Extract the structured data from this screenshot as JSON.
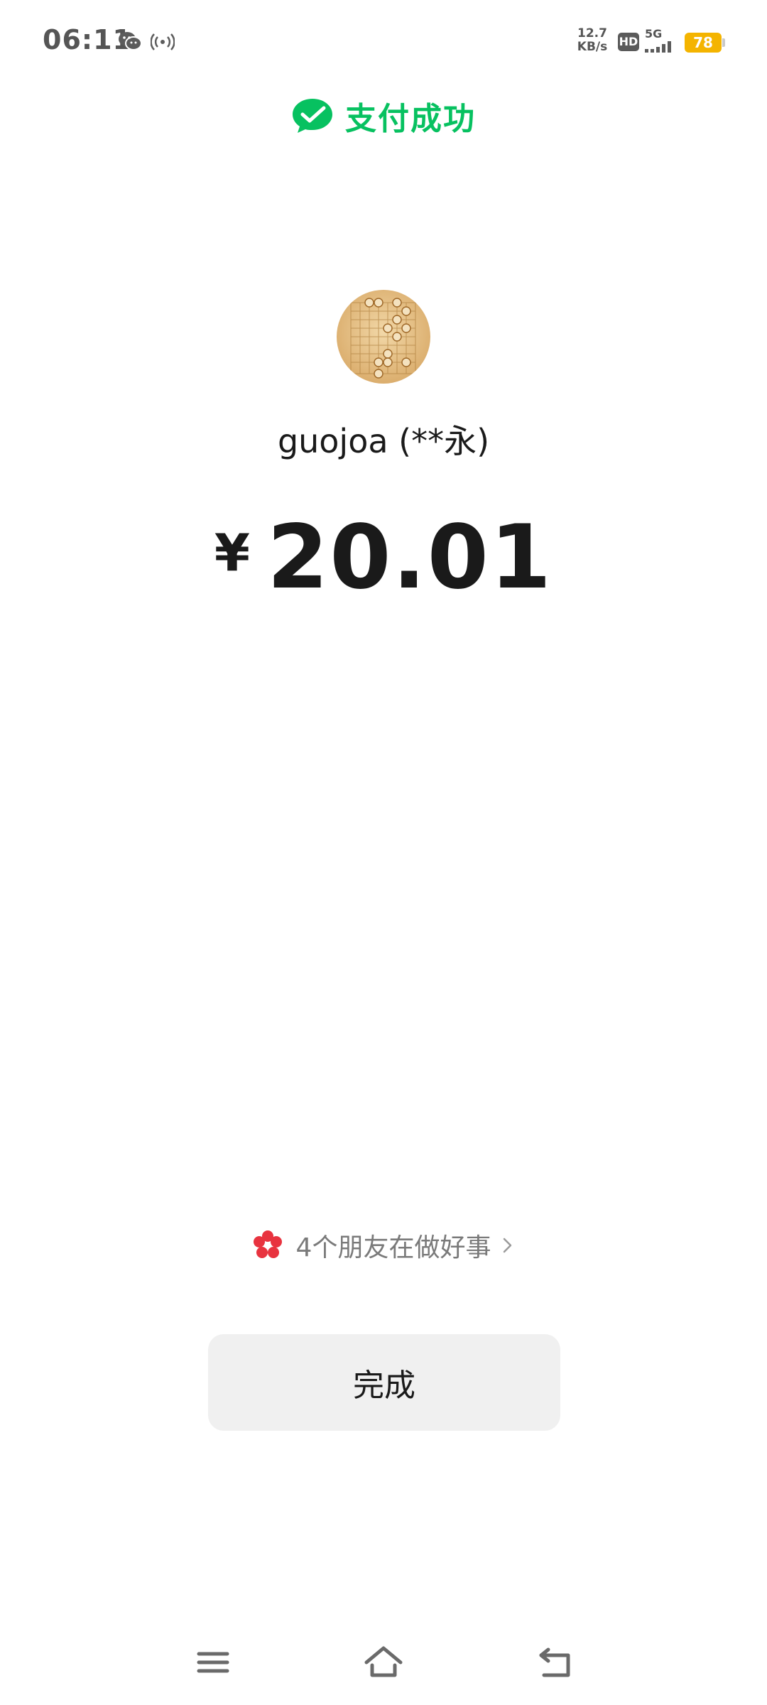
{
  "status_bar": {
    "time": "06:11",
    "net_speed_value": "12.7",
    "net_speed_unit": "KB/s",
    "hd_label": "HD",
    "network_label": "5G",
    "battery_level": "78",
    "icons": [
      "wechat-icon",
      "hotspot-icon",
      "hd-icon",
      "signal-icon",
      "battery-icon"
    ]
  },
  "header": {
    "title": "支付成功",
    "icon": "wechat-pay-check-icon",
    "accent_color": "#07c160"
  },
  "payee": {
    "avatar": "chinese-chess-board-avatar",
    "name": "guojoa (**永)"
  },
  "payment": {
    "currency_symbol": "¥",
    "amount": "20.01"
  },
  "promo": {
    "icon": "red-flower-icon",
    "text": "4个朋友在做好事",
    "chevron": "chevron-right-icon"
  },
  "actions": {
    "done_label": "完成"
  },
  "nav_bar": {
    "buttons": [
      "menu-icon",
      "home-icon",
      "back-icon"
    ]
  }
}
